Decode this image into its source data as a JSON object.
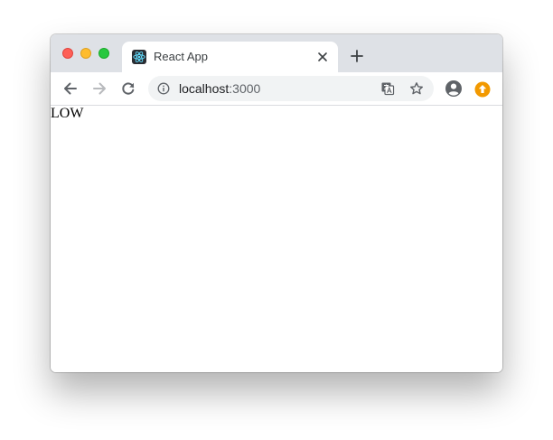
{
  "window": {
    "controls": [
      "close",
      "minimize",
      "maximize"
    ]
  },
  "tab": {
    "title": "React App",
    "favicon": "react-logo-icon",
    "close": "close-icon"
  },
  "toolbar": {
    "back": "arrow-left-icon",
    "forward": "arrow-right-icon",
    "reload": "reload-icon",
    "url_host": "localhost",
    "url_port": ":3000",
    "site_info": "info-icon",
    "translate": "translate-icon",
    "bookmark": "star-icon",
    "profile": "profile-icon",
    "update": "update-icon"
  },
  "page": {
    "text": "LOW"
  },
  "colors": {
    "tabstrip": "#dee1e6",
    "omnibox": "#f1f3f4",
    "update_badge": "#f29900",
    "react_blue": "#61dafb"
  }
}
